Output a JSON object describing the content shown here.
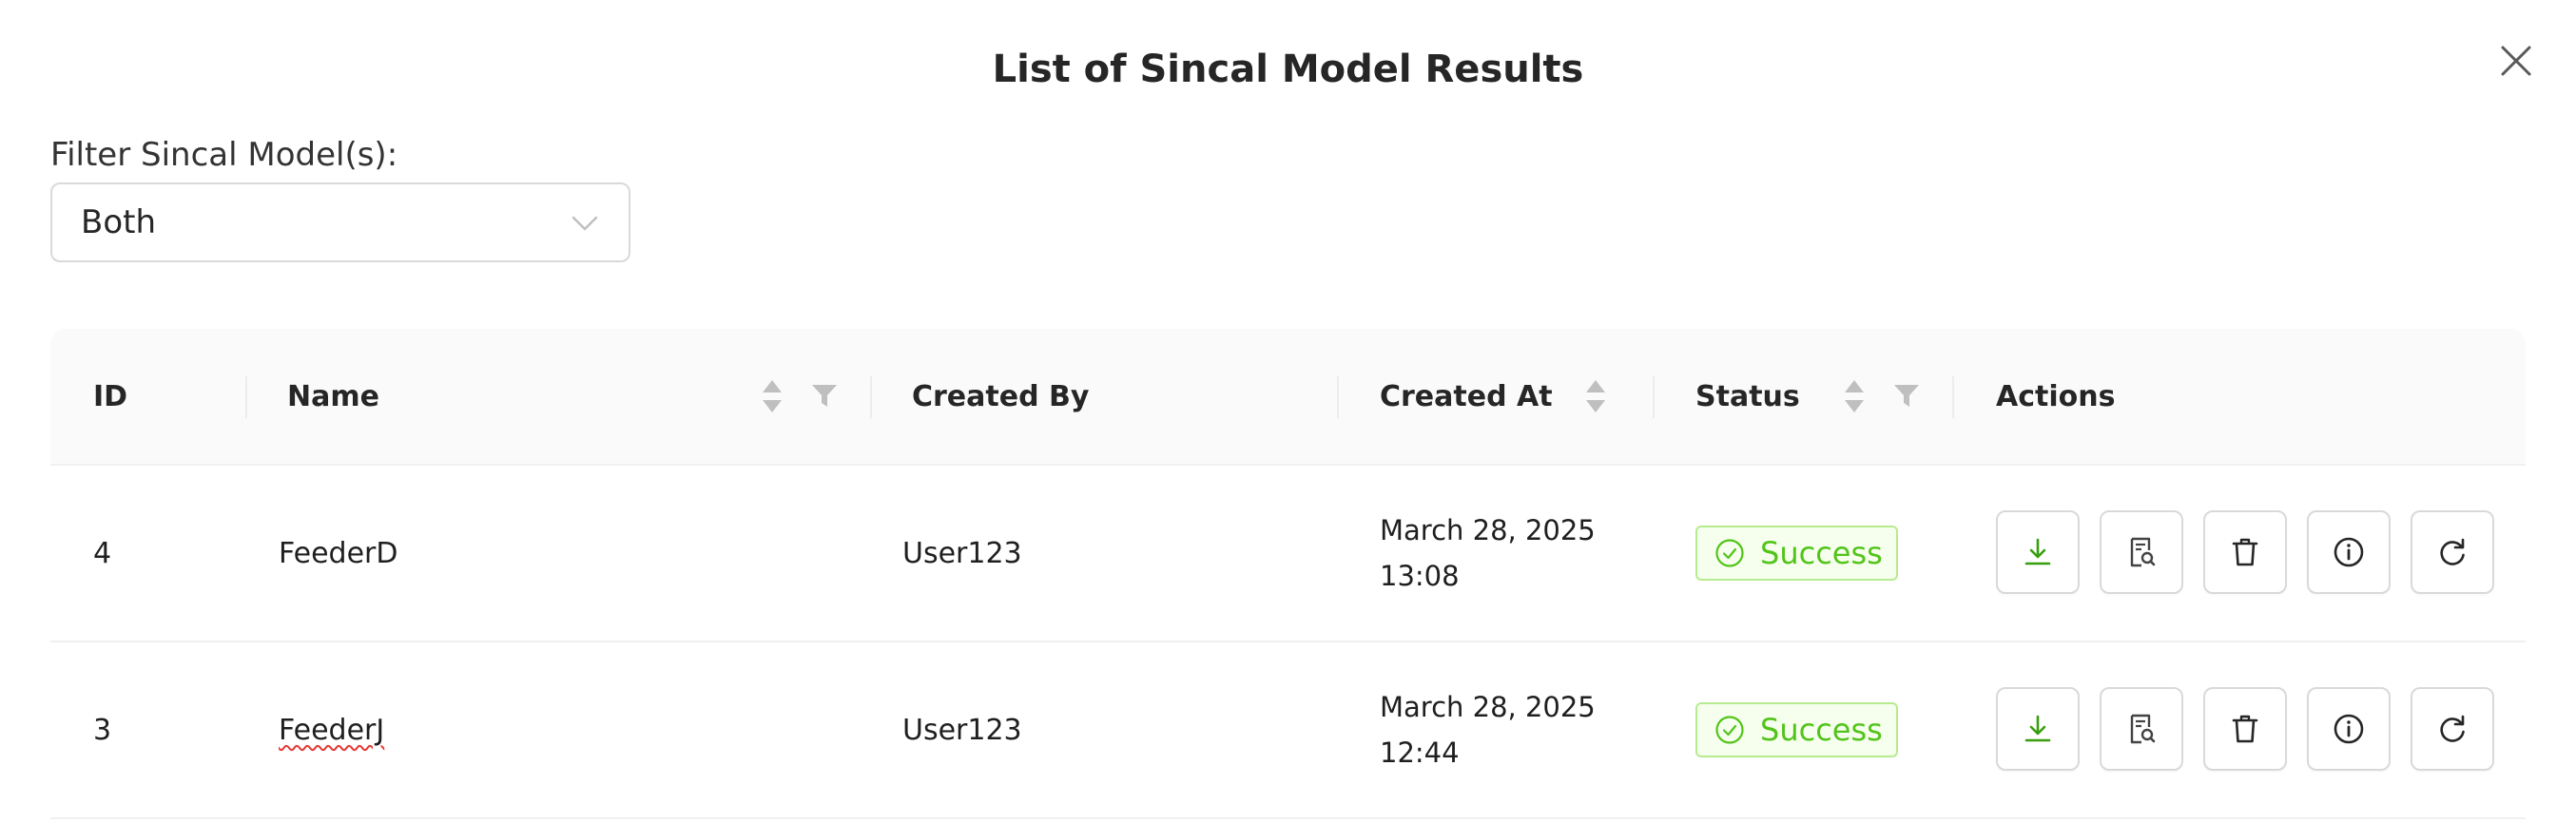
{
  "modal": {
    "title": "List of Sincal Model Results"
  },
  "filter": {
    "label": "Filter Sincal Model(s):",
    "selected": "Both"
  },
  "table": {
    "columns": {
      "id": "ID",
      "name": "Name",
      "created_by": "Created By",
      "created_at": "Created At",
      "status": "Status",
      "actions": "Actions"
    },
    "rows": [
      {
        "id": "4",
        "name": "FeederD",
        "created_by": "User123",
        "created_at_date": "March 28, 2025",
        "created_at_time": "13:08",
        "status": "Success"
      },
      {
        "id": "3",
        "name": "FeederJ",
        "created_by": "User123",
        "created_at_date": "March 28, 2025",
        "created_at_time": "12:44",
        "status": "Success"
      }
    ]
  },
  "icons": {
    "close": "close-icon",
    "chevron": "chevron-down-icon",
    "sort": "sort-icon",
    "filter": "filter-icon",
    "status": "check-circle-icon",
    "download": "download-icon",
    "view": "file-search-icon",
    "delete": "trash-icon",
    "info": "info-icon",
    "rerun": "reload-icon"
  },
  "colors": {
    "success_text": "#52c41a",
    "success_bg": "#f6ffed",
    "success_border": "#b7eb8f",
    "download_icon": "#389e0d",
    "header_bg": "#fafafa",
    "border": "#d9d9d9"
  }
}
